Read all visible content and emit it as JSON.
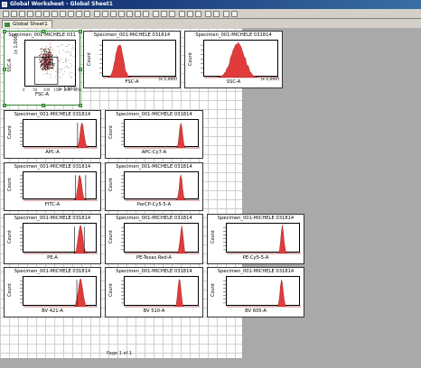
{
  "window": {
    "title": "Global Worksheet - Global Sheet1"
  },
  "toolbar": {
    "buttons": 28
  },
  "tabs": [
    {
      "label": "Global Sheet1"
    }
  ],
  "colors": {
    "histogram_fill": "#e03c3c",
    "gate": "#000000"
  },
  "plots": [
    {
      "kind": "dot",
      "title": "Specimen_001-MICHELE 031",
      "xlabel": "FSC-A",
      "ylabel": "SSC-A",
      "xunit": "(x 1,000)",
      "yunit": "(x 1,000)",
      "xticks": [
        "0",
        "50",
        "100",
        "150",
        "200",
        "250"
      ]
    },
    {
      "kind": "hist",
      "title": "Specimen_001-MICHELE 031814",
      "xlabel": "FSC-A",
      "ylabel": "Count",
      "xunit": "(x 1,000)",
      "peak": 0.22,
      "width": 0.05,
      "gates": []
    },
    {
      "kind": "hist",
      "title": "Specimen_001-MICHELE 031814",
      "xlabel": "SSC-A",
      "ylabel": "Count",
      "xunit": "(x 1,000)",
      "peak": 0.45,
      "width": 0.09,
      "gates": []
    },
    {
      "kind": "hist",
      "title": "Specimen_001-MICHELE 031814",
      "xlabel": "APC-A",
      "ylabel": "Count",
      "peak": 0.79,
      "width": 0.025,
      "gates": [
        0.73
      ]
    },
    {
      "kind": "hist",
      "title": "Specimen_001-MICHELE 031814",
      "xlabel": "APC-Cy7-A",
      "ylabel": "Count",
      "peak": 0.75,
      "width": 0.02,
      "gates": []
    },
    {
      "kind": "hist",
      "title": "Specimen_001-MICHELE 031814",
      "xlabel": "FITC-A",
      "ylabel": "Count",
      "peak": 0.76,
      "width": 0.025,
      "gates": [
        0.7,
        0.84
      ]
    },
    {
      "kind": "hist",
      "title": "Specimen_001-MICHELE 031814",
      "xlabel": "PerCP-Cy5-5-A",
      "ylabel": "Count",
      "peak": 0.75,
      "width": 0.02,
      "gates": []
    },
    {
      "kind": "hist",
      "title": "Specimen_001-MICHELE 031814",
      "xlabel": "PE-A",
      "ylabel": "Count",
      "peak": 0.77,
      "width": 0.03,
      "gates": [
        0.69,
        0.82
      ]
    },
    {
      "kind": "hist",
      "title": "Specimen_001-MICHELE 031814",
      "xlabel": "PE-Texas Red-A",
      "ylabel": "Count",
      "peak": 0.76,
      "width": 0.02,
      "gates": []
    },
    {
      "kind": "hist",
      "title": "Specimen_001-MICHELE 031814",
      "xlabel": "PE-Cy5-5-A",
      "ylabel": "Count",
      "peak": 0.75,
      "width": 0.02,
      "gates": []
    },
    {
      "kind": "hist",
      "title": "Specimen_001-MICHELE 031814",
      "xlabel": "BV 421-A",
      "ylabel": "Count",
      "peak": 0.77,
      "width": 0.03,
      "gates": [
        0.72
      ]
    },
    {
      "kind": "hist",
      "title": "Specimen_001-MICHELE 031814",
      "xlabel": "BV 510-A",
      "ylabel": "Count",
      "peak": 0.73,
      "width": 0.02,
      "gates": []
    },
    {
      "kind": "hist",
      "title": "Specimen_001-MICHELE 031814",
      "xlabel": "BV 605-A",
      "ylabel": "Count",
      "peak": 0.74,
      "width": 0.02,
      "gates": []
    }
  ],
  "footer": {
    "page": "Page 1 of 1"
  }
}
